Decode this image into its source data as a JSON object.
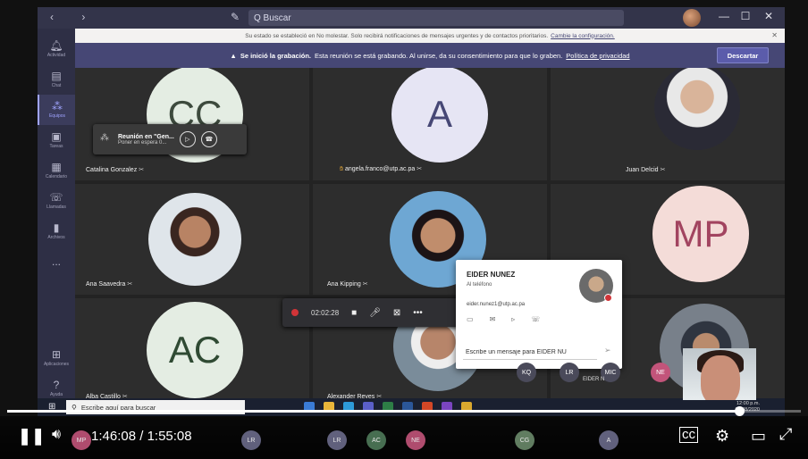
{
  "titlebar": {
    "search_placeholder": "Q Buscar",
    "nav_back": "‹",
    "nav_forward": "›",
    "minimize": "—",
    "maximize": "☐",
    "close": "✕"
  },
  "rail": {
    "items": [
      {
        "label": "Actividad",
        "icon": "bell-icon"
      },
      {
        "label": "Chat",
        "icon": "chat-icon"
      },
      {
        "label": "Equipos",
        "icon": "teams-icon",
        "active": true
      },
      {
        "label": "Tareas",
        "icon": "tasks-icon"
      },
      {
        "label": "Calendario",
        "icon": "calendar-icon"
      },
      {
        "label": "Llamadas",
        "icon": "phone-icon"
      },
      {
        "label": "Archivos",
        "icon": "files-icon"
      },
      {
        "label": "...",
        "icon": "more-icon"
      },
      {
        "label": "Aplicaciones",
        "icon": "apps-icon"
      },
      {
        "label": "Ayuda",
        "icon": "help-icon"
      }
    ]
  },
  "banner_dnd": {
    "text": "Su estado se estableció en No molestar. Solo recibirá notificaciones de mensajes urgentes y de contactos prioritarios.",
    "link": "Cambie la configuración.",
    "close": "✕"
  },
  "banner_recording": {
    "icon": "▲",
    "bold": "Se inició la grabación.",
    "text": "Esta reunión se está grabando. Al unirse, da su consentimiento para que lo graben.",
    "link": "Política de privacidad",
    "dismiss_label": "Descartar"
  },
  "participants": {
    "catalina": {
      "initials": "CC",
      "name": "Catalina Gonzalez"
    },
    "angela": {
      "initials": "A",
      "name": "angela.franco@utp.ac.pa"
    },
    "juan": {
      "name": "Juan Delcid"
    },
    "ana_s": {
      "name": "Ana Saavedra"
    },
    "ana_k": {
      "name": "Ana Kipping"
    },
    "mp": {
      "initials": "MP"
    },
    "alba": {
      "initials": "AC",
      "name": "Alba Castillo"
    },
    "alexander": {
      "name": "Alexander Reyes"
    }
  },
  "meeting_chip": {
    "title": "Reunión en \"Gen...",
    "subtitle": "Poner en espera  0..."
  },
  "call_bar": {
    "timer": "02:02:28"
  },
  "contact_card": {
    "name": "EIDER NUNEZ",
    "status": "Al teléfono",
    "email": "eider.nunez1@utp.ac.pa",
    "message_placeholder": "Escribe un mensaje para EIDER NU"
  },
  "mini_avatars": {
    "kq": "KQ",
    "lr": "LR",
    "mic": "MIC",
    "ne": "NE",
    "eider_label": "EIDER N"
  },
  "taskbar": {
    "search_placeholder": "Escribe aquí para buscar",
    "clock_time": "12:00 p.m.",
    "clock_date": "06/08/2020"
  },
  "player": {
    "current_time": "1:46:08",
    "separator": "/",
    "duration": "1:55:08",
    "progress": 0.922,
    "strip": [
      {
        "t": "MP",
        "c": "#c2547a"
      },
      {
        "t": "LR",
        "c": "#6b6b8a"
      },
      {
        "t": "LR",
        "c": "#6b6b8a"
      },
      {
        "t": "AC",
        "c": "#4f7a5a"
      },
      {
        "t": "NE",
        "c": "#c2547a"
      },
      {
        "t": "CG",
        "c": "#6b8a6b"
      },
      {
        "t": "A",
        "c": "#6b6b8a"
      }
    ]
  },
  "colors": {
    "teams_purple": "#464775",
    "recording_red": "#d13438",
    "avatar_green": "#e4ede3",
    "avatar_purple": "#e6e5f4",
    "avatar_pink": "#f4dcd8"
  }
}
